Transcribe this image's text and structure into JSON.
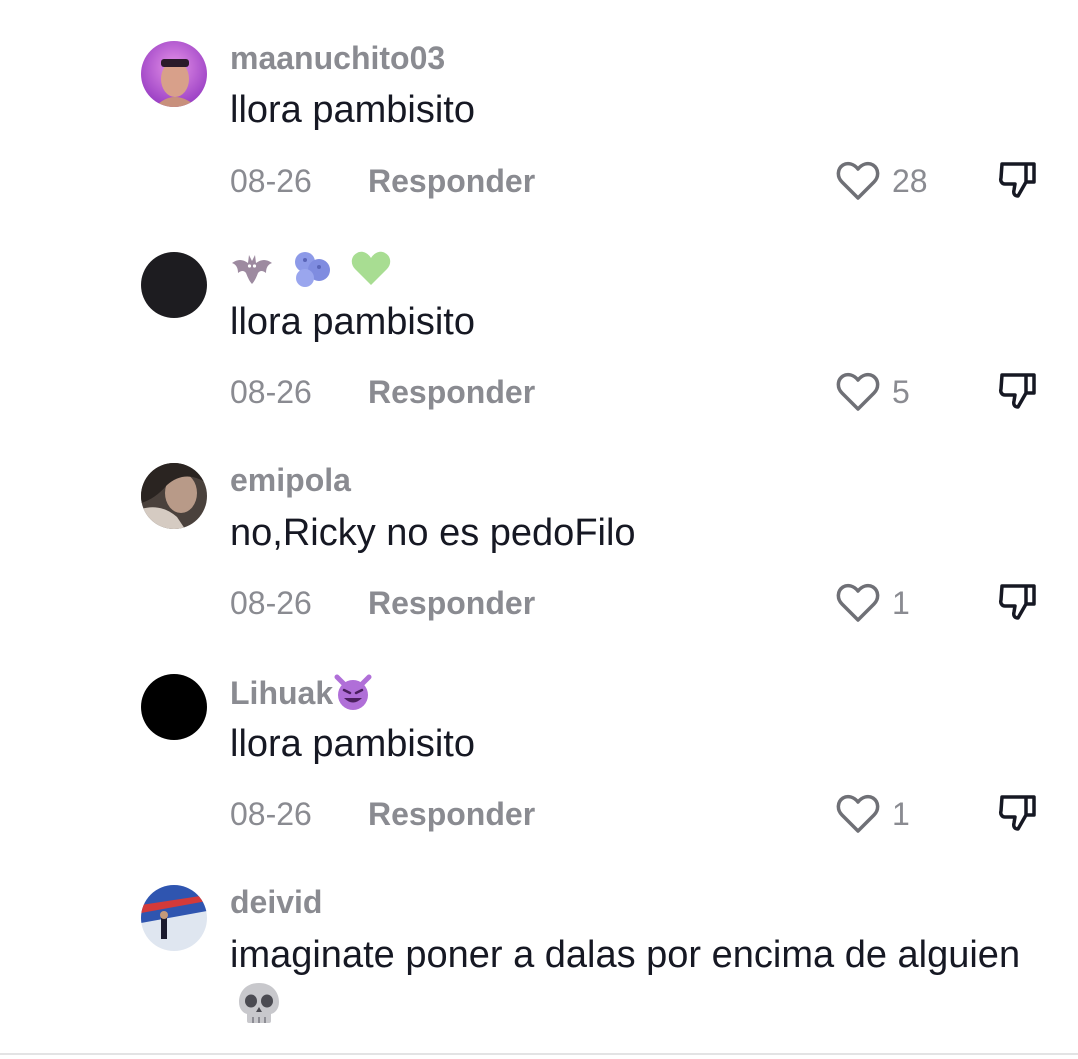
{
  "comments": [
    {
      "username": "maanuchito03",
      "text": "llora pambisito",
      "date": "08-26",
      "reply_label": "Responder",
      "likes": "28",
      "avatar_colors": [
        "#b04fd6",
        "#e07fe0"
      ]
    },
    {
      "username": "",
      "username_emojis": [
        "bat-emoji",
        "blueberries-emoji",
        "green-heart-emoji"
      ],
      "text": "llora pambisito",
      "date": "08-26",
      "reply_label": "Responder",
      "likes": "5",
      "avatar_colors": [
        "#1c1c1e",
        "#1c1c1e"
      ]
    },
    {
      "username": "emipola",
      "text": "no,Ricky no es pedoFilo",
      "date": "08-26",
      "reply_label": "Responder",
      "likes": "1",
      "avatar_colors": [
        "#3a3330",
        "#8a7a70"
      ]
    },
    {
      "username": "Lihuak",
      "username_emojis": [
        "smiling-devil-emoji"
      ],
      "text": "llora pambisito",
      "date": "08-26",
      "reply_label": "Responder",
      "likes": "1",
      "avatar_colors": [
        "#000000",
        "#000000"
      ]
    },
    {
      "username": "deivid",
      "text": "imaginate poner a dalas por encima de alguien",
      "text_emojis": [
        "skull-emoji"
      ],
      "avatar_colors": [
        "#2b4fa8",
        "#cfd8e8"
      ]
    }
  ],
  "colors": {
    "muted_text": "#8a8b91",
    "primary_text": "#161823"
  }
}
